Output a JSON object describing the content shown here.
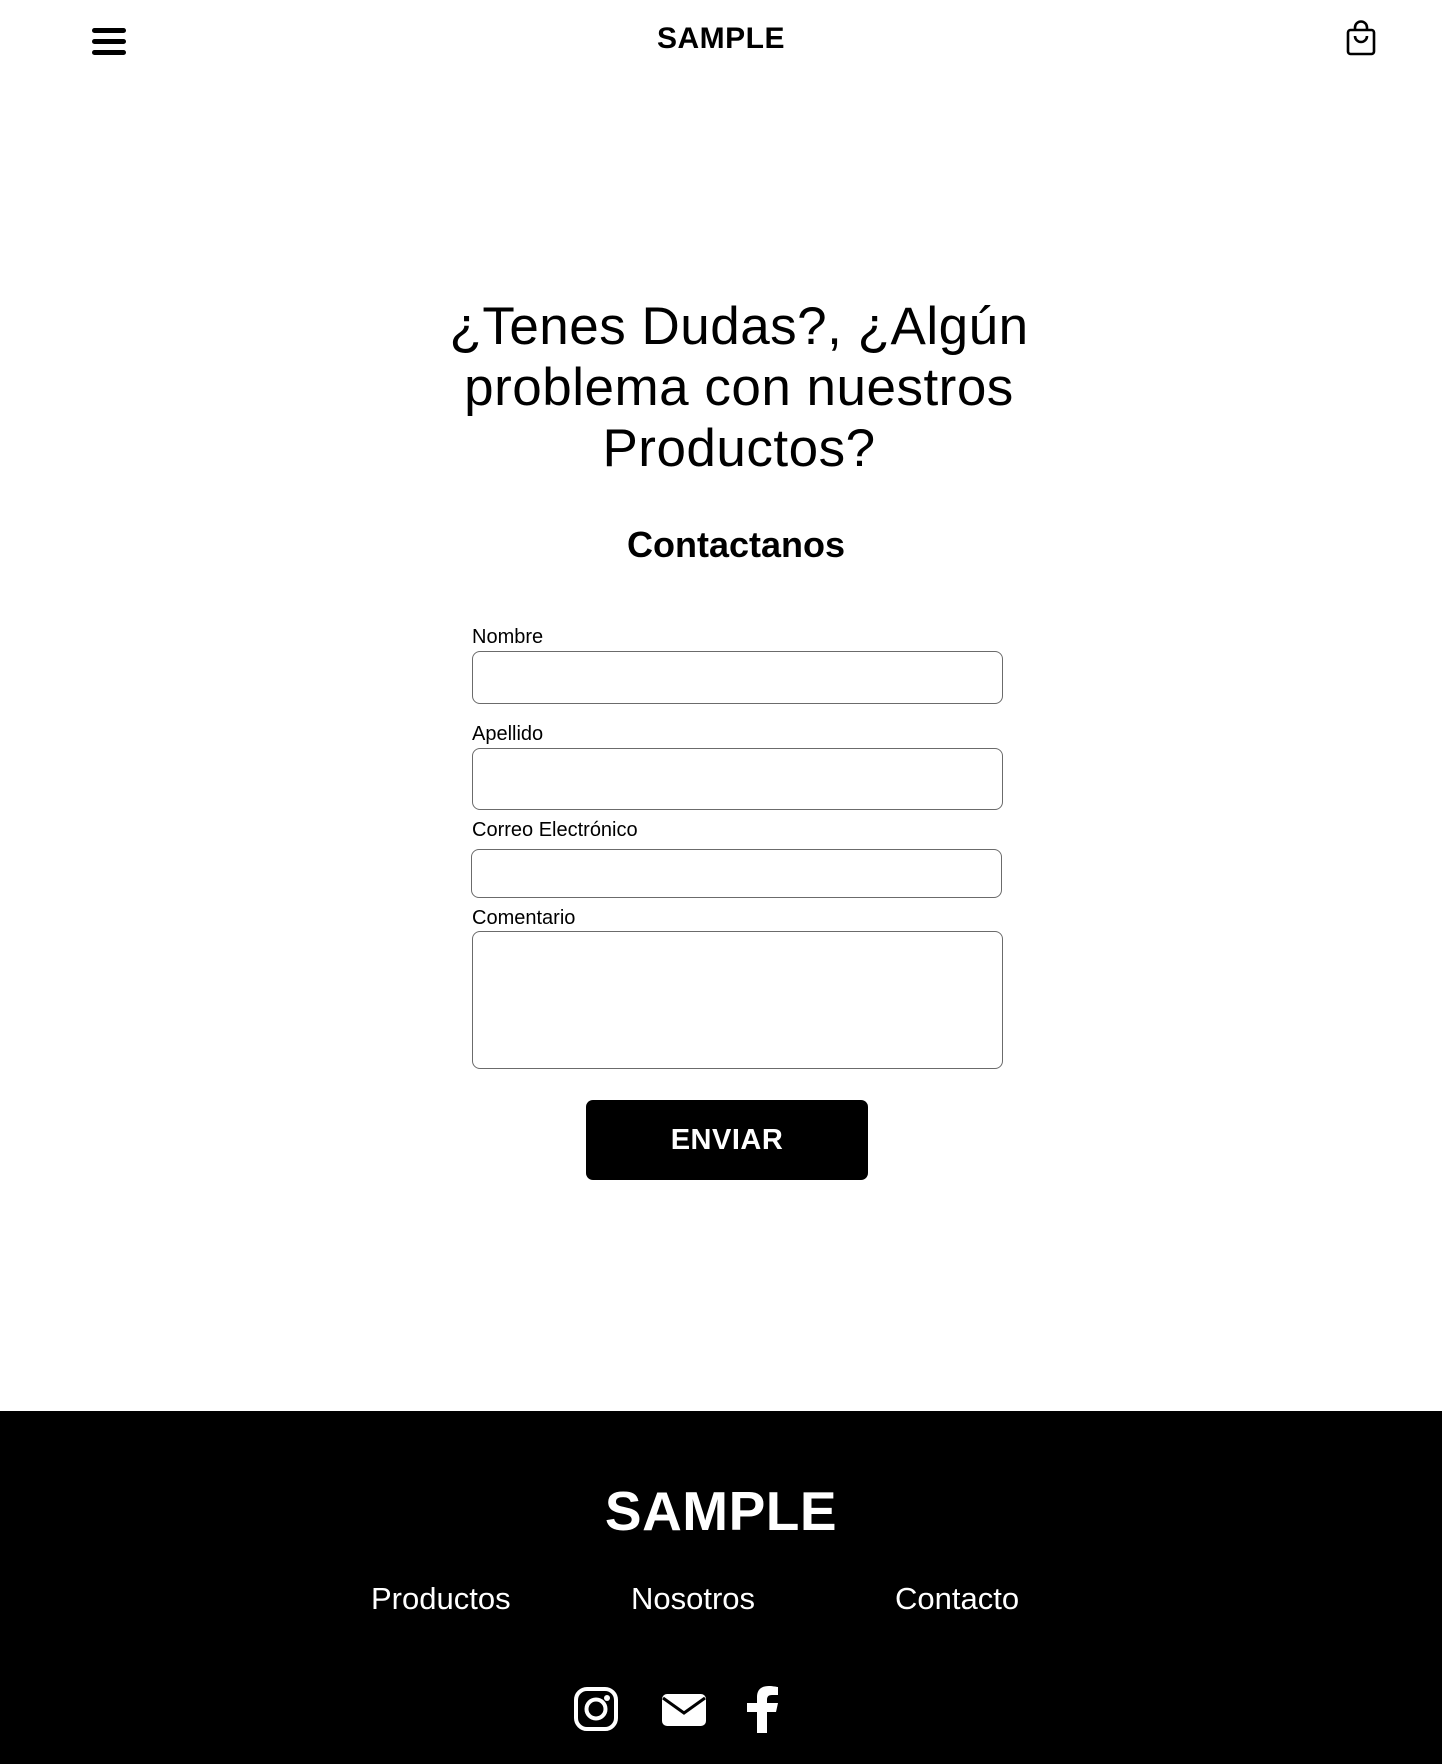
{
  "header": {
    "brand": "SAMPLE",
    "menu_icon": "hamburger-menu-icon",
    "cart_icon": "shopping-bag-icon"
  },
  "main": {
    "headline_lines": [
      "¿Tenes Dudas?, ¿Algún",
      "problema con nuestros",
      "Productos?"
    ],
    "subheading": "Contactanos"
  },
  "form": {
    "fields": [
      {
        "label": "Nombre",
        "value": "",
        "placeholder": ""
      },
      {
        "label": "Apellido",
        "value": "",
        "placeholder": ""
      },
      {
        "label": "Correo Electrónico",
        "value": "",
        "placeholder": ""
      },
      {
        "label": "Comentario",
        "value": "",
        "placeholder": ""
      }
    ],
    "submit_label": "ENVIAR"
  },
  "footer": {
    "brand": "SAMPLE",
    "links": [
      "Productos",
      "Nosotros",
      "Contacto"
    ],
    "social_icons": [
      "instagram-icon",
      "email-icon",
      "facebook-icon"
    ]
  },
  "colors": {
    "background": "#ffffff",
    "text": "#000000",
    "footer_background": "#000000",
    "footer_text": "#ffffff",
    "input_border": "#6b6b6b"
  }
}
